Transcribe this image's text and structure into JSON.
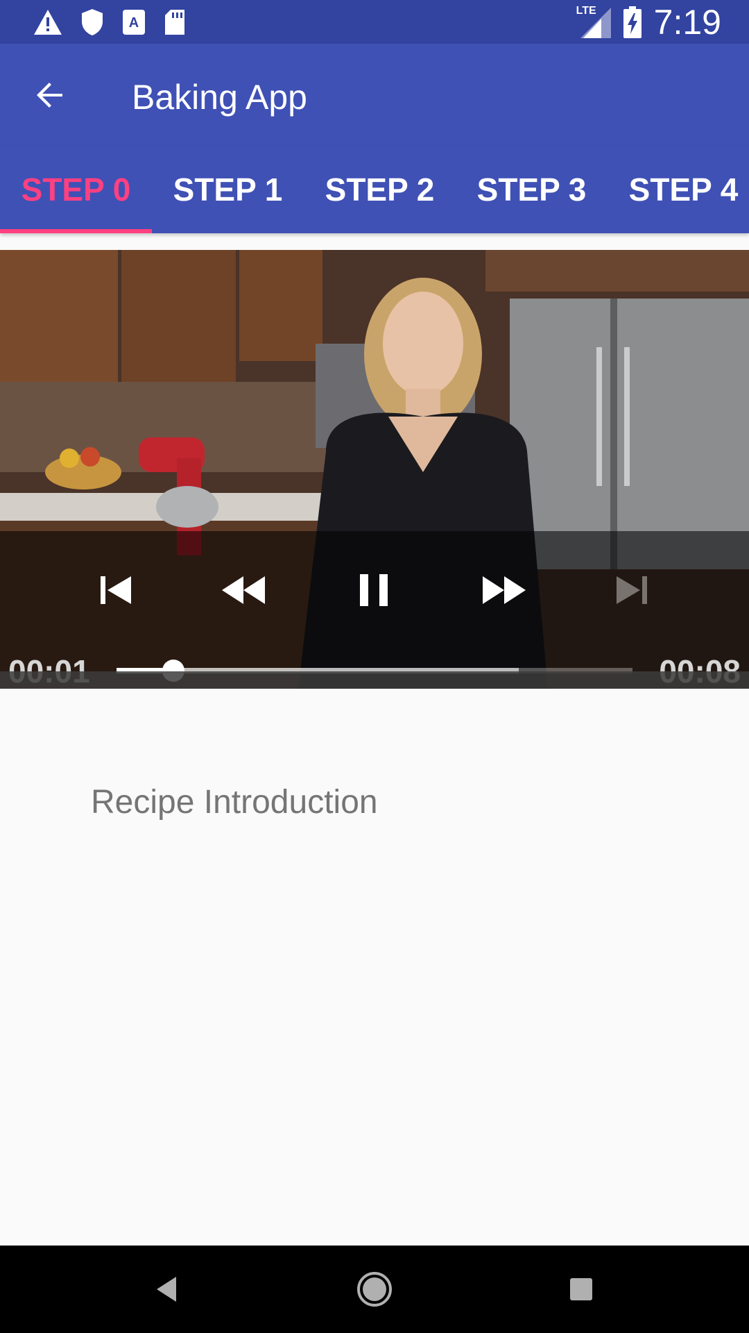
{
  "status_bar": {
    "time": "7:19",
    "network": "LTE",
    "icons": [
      "warning-icon",
      "shield-icon",
      "text-badge-icon",
      "sd-card-icon",
      "signal-icon",
      "battery-charging-icon"
    ]
  },
  "app_bar": {
    "title": "Baking App",
    "back_icon": "arrow-back-icon"
  },
  "tabs": [
    {
      "label": "STEP 0",
      "active": true
    },
    {
      "label": "STEP 1",
      "active": false
    },
    {
      "label": "STEP 2",
      "active": false
    },
    {
      "label": "STEP 3",
      "active": false
    },
    {
      "label": "STEP 4",
      "active": false
    }
  ],
  "player": {
    "position": "00:01",
    "duration": "00:08",
    "played_fraction": 0.11,
    "buffered_fraction": 0.78,
    "controls": [
      "skip-previous-icon",
      "rewind-icon",
      "pause-icon",
      "fast-forward-icon",
      "skip-next-icon"
    ]
  },
  "step": {
    "description": "Recipe Introduction"
  },
  "nav_bar": {
    "buttons": [
      "back-triangle-icon",
      "home-circle-icon",
      "recents-square-icon"
    ]
  },
  "colors": {
    "primary": "#3f51b5",
    "primary_dark": "#3243a0",
    "accent": "#ff4081",
    "description_text": "#757575"
  }
}
